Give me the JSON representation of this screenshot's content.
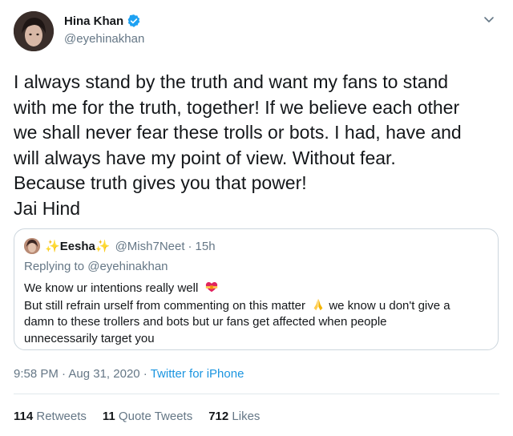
{
  "author": {
    "name": "Hina Khan",
    "handle": "@eyehinakhan",
    "verified_icon": "verified-badge",
    "verified_color": "#1da1f2"
  },
  "tweet": {
    "lines": [
      "I always stand by the truth and want my fans to stand",
      "with me for the truth, together! If we believe each other",
      "we shall never fear these trolls or bots. I had, have and",
      "will always have my point of view. Without fear.",
      "Because truth gives you that power!",
      "Jai Hind"
    ]
  },
  "quote": {
    "name_prefix": "✨",
    "name": "Eesha",
    "name_suffix": "✨",
    "handle": "@Mish7Neet",
    "dot": "·",
    "time": "15h",
    "replying_prefix": "Replying to ",
    "replying_to": "@eyehinakhan",
    "line1": "We know ur intentions really well",
    "line2a": "But still refrain urself from commenting on this matter",
    "line2b": " we know u don't give a",
    "line3": "damn to these trollers and bots but ur fans get affected when people",
    "line4": "unnecessarily target you",
    "emoji_icons": [
      "heart-ribbon-icon",
      "folded-hands-icon"
    ]
  },
  "meta": {
    "time": "9:58 PM",
    "sep": " · ",
    "date": "Aug 31, 2020",
    "sep2": " · ",
    "source": "Twitter for iPhone"
  },
  "stats": {
    "retweets_count": "114",
    "retweets_label": " Retweets",
    "quotes_count": "11",
    "quotes_label": " Quote Tweets",
    "likes_count": "712",
    "likes_label": " Likes"
  },
  "colors": {
    "link": "#1b95e0",
    "secondary": "#657786",
    "border": "#ccd6dd"
  }
}
